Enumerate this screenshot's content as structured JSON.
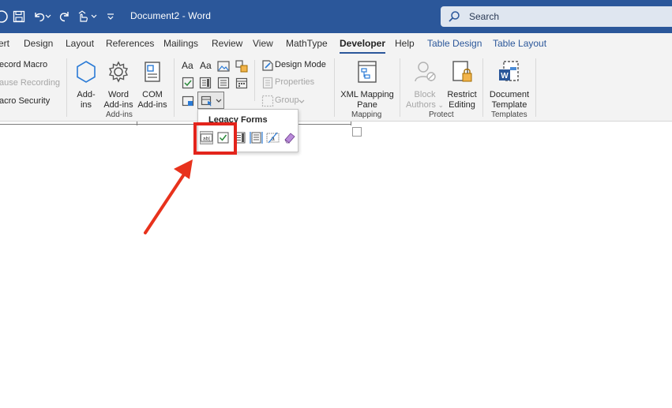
{
  "window": {
    "title": "Document2  -  Word"
  },
  "search": {
    "placeholder": "Search"
  },
  "tabs": [
    {
      "label": "ert"
    },
    {
      "label": "Design"
    },
    {
      "label": "Layout"
    },
    {
      "label": "References"
    },
    {
      "label": "Mailings"
    },
    {
      "label": "Review"
    },
    {
      "label": "View"
    },
    {
      "label": "MathType"
    },
    {
      "label": "Developer"
    },
    {
      "label": "Help"
    },
    {
      "label": "Table Design"
    },
    {
      "label": "Table Layout"
    }
  ],
  "code_group": {
    "record_macro": "ecord Macro",
    "pause_recording": "ause Recording",
    "macro_security": "acro Security"
  },
  "addins_group": {
    "label": "Add-ins",
    "addins": {
      "line1": "Add-",
      "line2": "ins"
    },
    "word_addins": {
      "line1": "Word",
      "line2": "Add-ins"
    },
    "com_addins": {
      "line1": "COM",
      "line2": "Add-ins"
    }
  },
  "controls_group": {
    "design_mode": "Design Mode",
    "properties": "Properties",
    "group": "Group"
  },
  "mapping_group": {
    "label": "Mapping",
    "xml_pane": {
      "line1": "XML Mapping",
      "line2": "Pane"
    }
  },
  "protect_group": {
    "label": "Protect",
    "block_authors": {
      "line1": "Block",
      "line2": "Authors"
    },
    "restrict_editing": {
      "line1": "Restrict",
      "line2": "Editing"
    }
  },
  "templates_group": {
    "label": "Templates",
    "document_template": {
      "line1": "Document",
      "line2": "Template"
    }
  },
  "legacy_forms": {
    "title": "Legacy Forms",
    "items": [
      "text-form-field",
      "check-box-form-field",
      "drop-down-form-field",
      "insert-frame",
      "form-field-shading",
      "reset-form-fields"
    ]
  },
  "colors": {
    "titlebar": "#2b579a",
    "highlight": "#e3241b",
    "arrow": "#e8321c"
  }
}
